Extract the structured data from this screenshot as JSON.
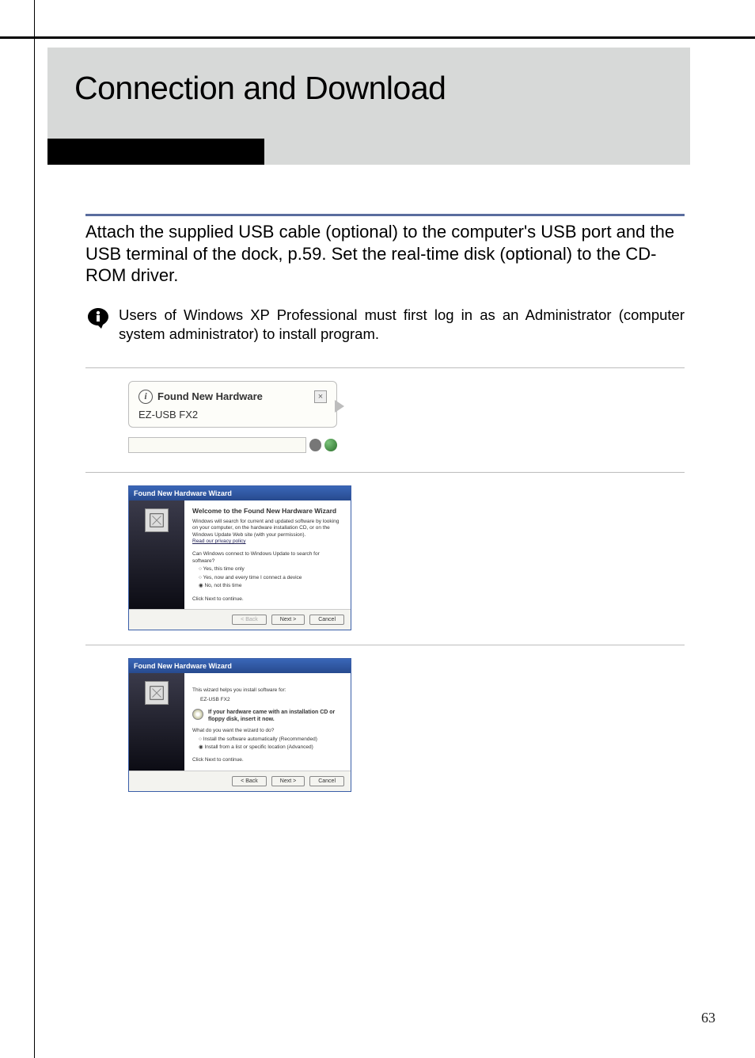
{
  "chapter": {
    "title": "Connection and Download"
  },
  "intro": "Attach the supplied USB cable (optional) to the computer's USB port and the USB terminal of the dock, p.59. Set the real-time disk (optional) to the CD-ROM driver.",
  "note": "Users of Windows XP Professional must first log in as an Administrator (computer system administrator) to install program.",
  "balloon": {
    "title": "Found New Hardware",
    "device": "EZ-USB FX2"
  },
  "wizard1": {
    "titlebar": "Found New Hardware Wizard",
    "heading": "Welcome to the Found New Hardware Wizard",
    "para1": "Windows will search for current and updated software by looking on your computer, on the hardware installation CD, or on the Windows Update Web site (with your permission).",
    "privacy_link": "Read our privacy policy",
    "question": "Can Windows connect to Windows Update to search for software?",
    "opt1": "Yes, this time only",
    "opt2": "Yes, now and every time I connect a device",
    "opt3": "No, not this time",
    "continue": "Click Next to continue.",
    "btn_back": "< Back",
    "btn_next": "Next >",
    "btn_cancel": "Cancel"
  },
  "wizard2": {
    "titlebar": "Found New Hardware Wizard",
    "helps": "This wizard helps you install software for:",
    "device": "EZ-USB FX2",
    "cd_text": "If your hardware came with an installation CD or floppy disk, insert it now.",
    "question": "What do you want the wizard to do?",
    "opt1": "Install the software automatically (Recommended)",
    "opt2": "Install from a list or specific location (Advanced)",
    "continue": "Click Next to continue.",
    "btn_back": "< Back",
    "btn_next": "Next >",
    "btn_cancel": "Cancel"
  },
  "page_number": "63"
}
